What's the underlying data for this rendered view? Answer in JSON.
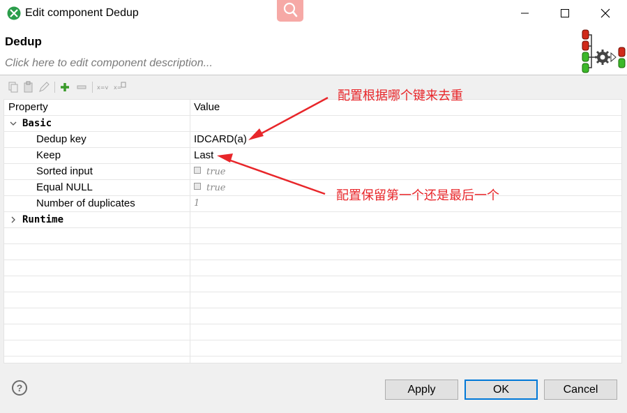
{
  "window": {
    "title": "Edit component Dedup",
    "controls": {
      "minimize": "minimize-icon",
      "maximize": "maximize-icon",
      "close": "close-icon"
    }
  },
  "header": {
    "component_name": "Dedup",
    "description_placeholder": "Click here to edit component description..."
  },
  "table": {
    "columns": [
      "Property",
      "Value"
    ],
    "categories": {
      "basic": "Basic",
      "runtime": "Runtime"
    },
    "rows": [
      {
        "label": "Dedup key",
        "value": "IDCARD(a)"
      },
      {
        "label": "Keep",
        "value": "Last"
      },
      {
        "label": "Sorted input",
        "value": "true",
        "checkbox": true
      },
      {
        "label": "Equal NULL",
        "value": "true",
        "checkbox": true
      },
      {
        "label": "Number of duplicates",
        "value": "1"
      }
    ]
  },
  "footer": {
    "help": "?",
    "apply": "Apply",
    "ok": "OK",
    "cancel": "Cancel"
  },
  "annotations": {
    "dedup_key_note": "配置根据哪个键来去重",
    "keep_note": "配置保留第一个还是最后一个"
  },
  "colors": {
    "annotation": "#e8262a",
    "ok_border": "#0078d7",
    "app_icon": "#2a9d4a"
  }
}
